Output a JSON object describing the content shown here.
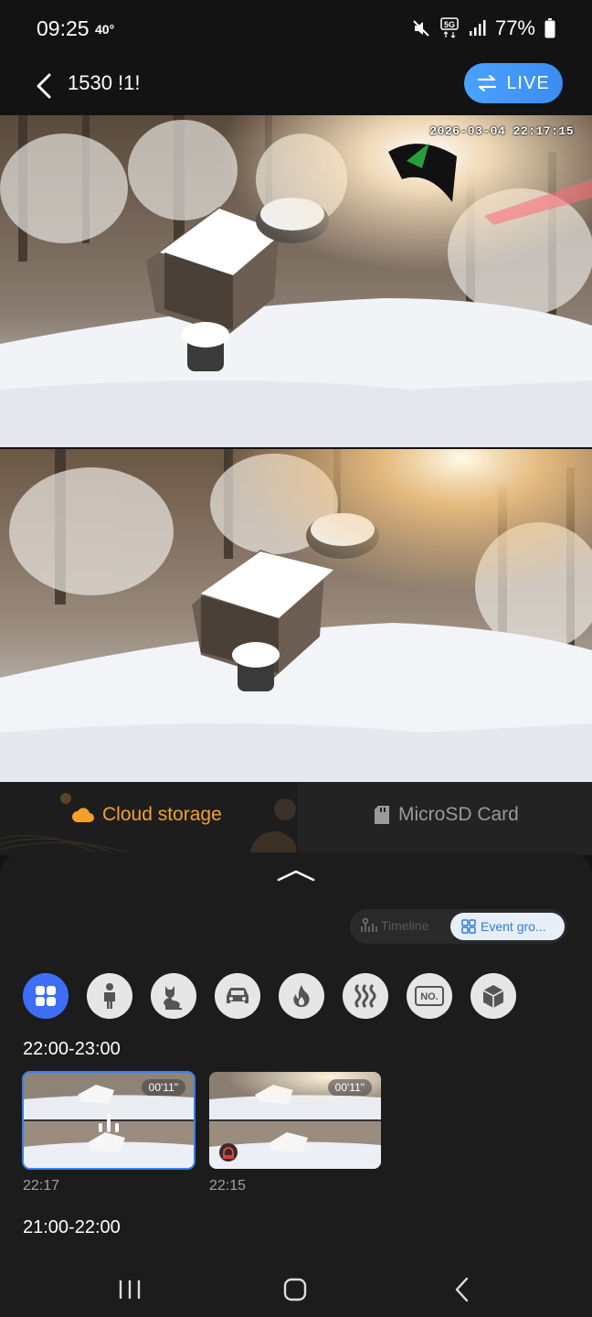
{
  "status_bar": {
    "time": "09:25",
    "temperature": "40°",
    "network": "5G",
    "battery": "77%",
    "icons": [
      "mute-icon",
      "network-5g-icon",
      "signal-icon",
      "battery-icon"
    ]
  },
  "header": {
    "title": "1530 !1!",
    "live_label": "LIVE",
    "accent_color": "#4aa2ff"
  },
  "camera": {
    "timestamp": "2026-03-04 22:17:15"
  },
  "storage_tabs": {
    "cloud_label": "Cloud storage",
    "sd_label": "MicroSD Card",
    "active": "cloud",
    "active_color": "#f5a02a"
  },
  "view_toggle": {
    "timeline_label": "Timeline",
    "event_label": "Event gro...",
    "active": "event"
  },
  "filters": [
    {
      "name": "all",
      "icon": "grid-icon",
      "active": true
    },
    {
      "name": "person",
      "icon": "person-icon",
      "active": false
    },
    {
      "name": "pet",
      "icon": "pet-icon",
      "active": false
    },
    {
      "name": "vehicle",
      "icon": "car-icon",
      "active": false
    },
    {
      "name": "fire",
      "icon": "flame-icon",
      "active": false
    },
    {
      "name": "heat",
      "icon": "heat-icon",
      "active": false
    },
    {
      "name": "license-plate",
      "icon": "plate-icon",
      "active": false
    },
    {
      "name": "package",
      "icon": "package-icon",
      "active": false
    }
  ],
  "plate_icon_text": "NO.",
  "event_groups": [
    {
      "label": "22:00-23:00",
      "clips": [
        {
          "duration": "00'11\"",
          "time": "22:17",
          "selected": true,
          "badge": "playing-icon"
        },
        {
          "duration": "00'11\"",
          "time": "22:15",
          "selected": false,
          "badge": "alarm-icon"
        }
      ]
    },
    {
      "label": "21:00-22:00",
      "clips": []
    }
  ],
  "nav_bar": {
    "buttons": [
      "recents-icon",
      "home-icon",
      "back-icon"
    ]
  }
}
